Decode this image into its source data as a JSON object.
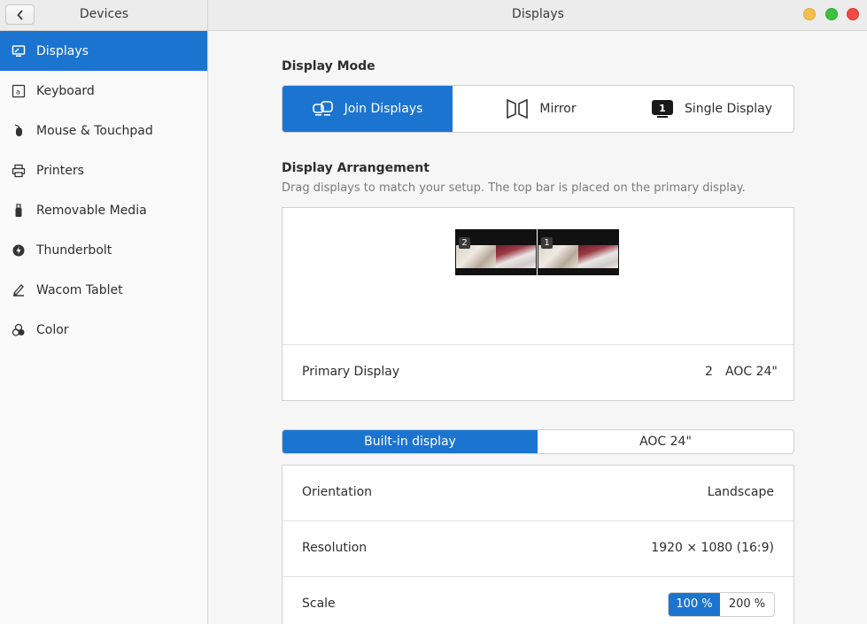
{
  "header": {
    "left_title": "Devices",
    "title": "Displays"
  },
  "sidebar": {
    "items": [
      {
        "label": "Displays",
        "icon": "display-icon"
      },
      {
        "label": "Keyboard",
        "icon": "keyboard-icon"
      },
      {
        "label": "Mouse & Touchpad",
        "icon": "mouse-icon"
      },
      {
        "label": "Printers",
        "icon": "printer-icon"
      },
      {
        "label": "Removable Media",
        "icon": "usb-drive-icon"
      },
      {
        "label": "Thunderbolt",
        "icon": "thunderbolt-icon"
      },
      {
        "label": "Wacom Tablet",
        "icon": "tablet-pen-icon"
      },
      {
        "label": "Color",
        "icon": "color-circles-icon"
      }
    ],
    "active_index": 0
  },
  "display_mode": {
    "title": "Display Mode",
    "options": [
      {
        "label": "Join Displays",
        "icon": "join-displays-icon"
      },
      {
        "label": "Mirror",
        "icon": "mirror-icon"
      },
      {
        "label": "Single Display",
        "icon": "single-display-icon",
        "badge": "1"
      }
    ],
    "active_index": 0
  },
  "arrangement": {
    "title": "Display Arrangement",
    "subtitle": "Drag displays to match your setup. The top bar is placed on the primary display.",
    "monitors": [
      {
        "number": "2"
      },
      {
        "number": "1"
      }
    ],
    "primary_label": "Primary Display",
    "primary_number": "2",
    "primary_name": "AOC 24\""
  },
  "display_tabs": {
    "tabs": [
      "Built-in display",
      "AOC 24\""
    ],
    "active_index": 0
  },
  "settings": {
    "orientation_label": "Orientation",
    "orientation_value": "Landscape",
    "resolution_label": "Resolution",
    "resolution_value": "1920 × 1080 (16:9)",
    "scale_label": "Scale",
    "scale_options": [
      "100 %",
      "200 %"
    ],
    "scale_active_index": 0
  },
  "colors": {
    "accent": "#1c74d1"
  }
}
